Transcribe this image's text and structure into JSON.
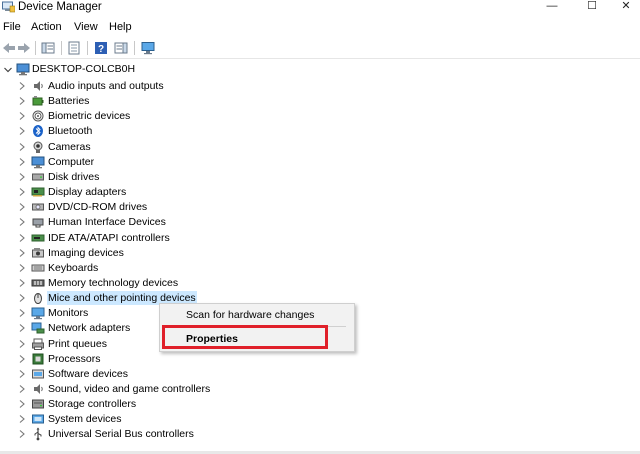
{
  "window": {
    "title": "Device Manager",
    "minimize_glyph": "—",
    "maximize_glyph": "☐",
    "close_glyph": "✕"
  },
  "menu": [
    "File",
    "Action",
    "View",
    "Help"
  ],
  "toolbar_icons": [
    "back-arrow-icon",
    "forward-arrow-icon",
    "show-hide-console-tree-icon",
    "properties-icon",
    "help-icon",
    "action-pane-icon",
    "monitor-scan-icon"
  ],
  "tree": {
    "root": "DESKTOP-COLCB0H",
    "items": [
      {
        "label": "Audio inputs and outputs",
        "icon": "speaker-icon"
      },
      {
        "label": "Batteries",
        "icon": "battery-icon"
      },
      {
        "label": "Biometric devices",
        "icon": "biometric-icon"
      },
      {
        "label": "Bluetooth",
        "icon": "bluetooth-icon"
      },
      {
        "label": "Cameras",
        "icon": "camera-icon"
      },
      {
        "label": "Computer",
        "icon": "computer-icon"
      },
      {
        "label": "Disk drives",
        "icon": "disk-drive-icon"
      },
      {
        "label": "Display adapters",
        "icon": "display-adapter-icon"
      },
      {
        "label": "DVD/CD-ROM drives",
        "icon": "dvd-drive-icon"
      },
      {
        "label": "Human Interface Devices",
        "icon": "hid-icon"
      },
      {
        "label": "IDE ATA/ATAPI controllers",
        "icon": "ide-controller-icon"
      },
      {
        "label": "Imaging devices",
        "icon": "imaging-icon"
      },
      {
        "label": "Keyboards",
        "icon": "keyboard-icon"
      },
      {
        "label": "Memory technology devices",
        "icon": "memory-icon"
      },
      {
        "label": "Mice and other pointing devices",
        "icon": "mouse-icon"
      },
      {
        "label": "Monitors",
        "icon": "monitor-icon"
      },
      {
        "label": "Network adapters",
        "icon": "network-adapter-icon"
      },
      {
        "label": "Print queues",
        "icon": "printer-icon"
      },
      {
        "label": "Processors",
        "icon": "processor-icon"
      },
      {
        "label": "Software devices",
        "icon": "software-device-icon"
      },
      {
        "label": "Sound, video and game controllers",
        "icon": "sound-icon"
      },
      {
        "label": "Storage controllers",
        "icon": "storage-controller-icon"
      },
      {
        "label": "System devices",
        "icon": "system-device-icon"
      },
      {
        "label": "Universal Serial Bus controllers",
        "icon": "usb-icon"
      }
    ],
    "selected_index": 14
  },
  "context_menu": {
    "items": [
      "Scan for hardware changes",
      "Properties"
    ],
    "highlighted": "Properties"
  },
  "colors": {
    "selection": "#cce8ff",
    "highlight_box": "#e0202a",
    "menu_bg": "#f2f2f2"
  }
}
